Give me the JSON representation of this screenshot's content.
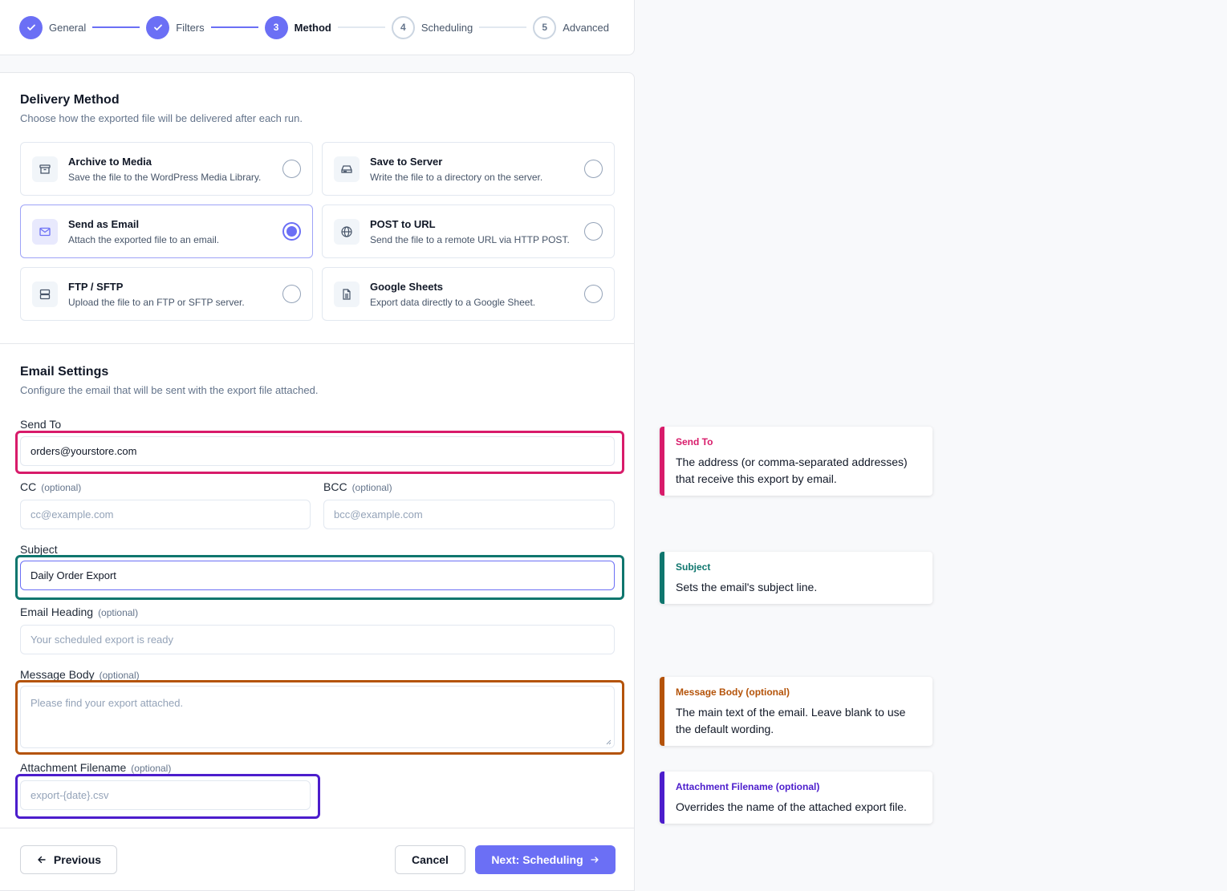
{
  "stepper": {
    "steps": [
      {
        "num": "",
        "label": "General",
        "state": "done"
      },
      {
        "num": "",
        "label": "Filters",
        "state": "done"
      },
      {
        "num": "3",
        "label": "Method",
        "state": "active"
      },
      {
        "num": "4",
        "label": "Scheduling",
        "state": "pending"
      },
      {
        "num": "5",
        "label": "Advanced",
        "state": "pending"
      }
    ]
  },
  "delivery": {
    "title": "Delivery Method",
    "subtitle": "Choose how the exported file will be delivered after each run.",
    "options": [
      {
        "title": "Archive to Media",
        "desc": "Save the file to the WordPress Media Library.",
        "icon": "archive-icon"
      },
      {
        "title": "Save to Server",
        "desc": "Write the file to a directory on the server.",
        "icon": "hard-drive-icon"
      },
      {
        "title": "Send as Email",
        "desc": "Attach the exported file to an email.",
        "icon": "mail-icon",
        "selected": true
      },
      {
        "title": "POST to URL",
        "desc": "Send the file to a remote URL via HTTP POST.",
        "icon": "globe-icon"
      },
      {
        "title": "FTP / SFTP",
        "desc": "Upload the file to an FTP or SFTP server.",
        "icon": "server-icon"
      },
      {
        "title": "Google Sheets",
        "desc": "Export data directly to a Google Sheet.",
        "icon": "spreadsheet-icon"
      }
    ]
  },
  "email": {
    "title": "Email Settings",
    "subtitle": "Configure the email that will be sent with the export file attached.",
    "send_to": {
      "label": "Send To",
      "value": "orders@yourstore.com"
    },
    "cc": {
      "label": "CC",
      "tag": "(optional)",
      "placeholder": "cc@example.com"
    },
    "bcc": {
      "label": "BCC",
      "tag": "(optional)",
      "placeholder": "bcc@example.com"
    },
    "subject": {
      "label": "Subject",
      "value": "Daily Order Export"
    },
    "heading": {
      "label": "Email Heading",
      "tag": "(optional)",
      "placeholder": "Your scheduled export is ready"
    },
    "body": {
      "label": "Message Body",
      "tag": "(optional)",
      "placeholder": "Please find your export attached."
    },
    "filename": {
      "label": "Attachment Filename",
      "tag": "(optional)",
      "placeholder": "export-{date}.csv"
    }
  },
  "footer": {
    "previous": "Previous",
    "cancel": "Cancel",
    "next": "Next: Scheduling"
  },
  "annotations": [
    {
      "title": "Send To",
      "body": "The address (or comma-separated addresses) that receive this export by email.",
      "color": "#d81b6a"
    },
    {
      "title": "Subject",
      "body": "Sets the email's subject line.",
      "color": "#0f766e"
    },
    {
      "title": "Message Body (optional)",
      "body": "The main text of the email. Leave blank to use the default wording.",
      "color": "#b45309"
    },
    {
      "title": "Attachment Filename (optional)",
      "body": "Overrides the name of the attached export file.",
      "color": "#4c1dcc"
    }
  ],
  "colors": {
    "accent": "#6b6ff5"
  }
}
